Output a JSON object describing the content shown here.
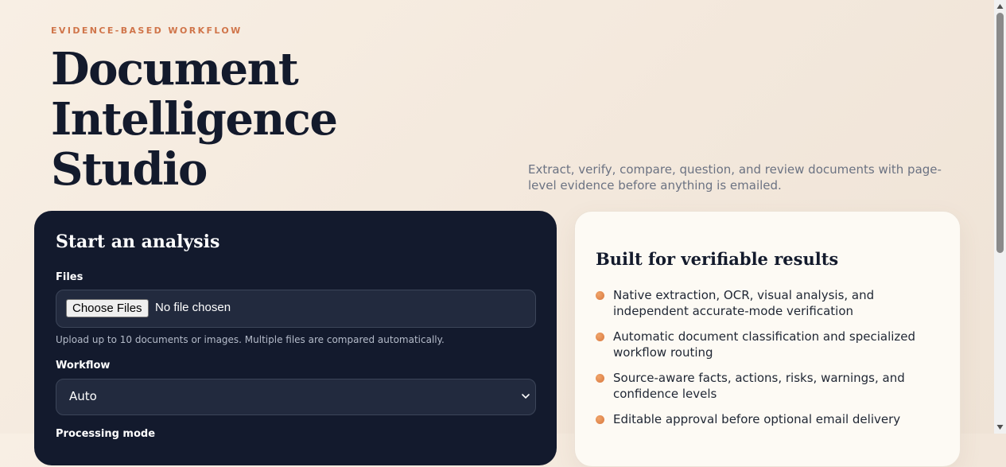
{
  "hero": {
    "eyebrow": "EVIDENCE-BASED WORKFLOW",
    "title_lines": [
      "Document",
      "Intelligence",
      "Studio"
    ],
    "tagline": "Extract, verify, compare, question, and review documents with page-level evidence before anything is emailed."
  },
  "analysis_panel": {
    "title": "Start an analysis",
    "files_label": "Files",
    "choose_files_button": "Choose Files",
    "file_status": "No file chosen",
    "files_hint": "Upload up to 10 documents or images. Multiple files are compared automatically.",
    "workflow_label": "Workflow",
    "workflow_value": "Auto",
    "processing_mode_label": "Processing mode"
  },
  "features_panel": {
    "title": "Built for verifiable results",
    "items": [
      "Native extraction, OCR, visual analysis, and independent accurate-mode verification",
      "Automatic document classification and specialized workflow routing",
      "Source-aware facts, actions, risks, warnings, and confidence levels",
      "Editable approval before optional email delivery"
    ]
  },
  "colors": {
    "accent": "#d0754a",
    "dark_panel": "#131a2d",
    "light_panel": "#fdfaf4",
    "bullet": "#e08a4f"
  }
}
